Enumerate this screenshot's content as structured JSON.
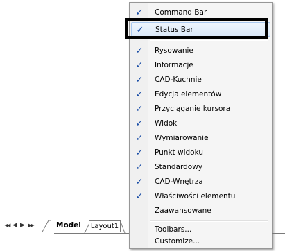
{
  "menu": {
    "items": [
      {
        "label": "Command Bar",
        "checked": true
      },
      {
        "label": "Status Bar",
        "checked": true,
        "highlighted": true
      },
      {
        "label": "Rysowanie",
        "checked": true
      },
      {
        "label": "Informacje",
        "checked": true
      },
      {
        "label": "CAD-Kuchnie",
        "checked": true
      },
      {
        "label": "Edycja elementów",
        "checked": true
      },
      {
        "label": "Przyciąganie kursora",
        "checked": true
      },
      {
        "label": "Widok",
        "checked": true
      },
      {
        "label": "Wymiarowanie",
        "checked": true
      },
      {
        "label": "Punkt widoku",
        "checked": true
      },
      {
        "label": "Standardowy",
        "checked": true
      },
      {
        "label": "CAD-Wnętrza",
        "checked": true
      },
      {
        "label": "Właściwości elementu",
        "checked": true
      },
      {
        "label": "Zaawansowane",
        "checked": false
      },
      {
        "label": "Toolbars...",
        "checked": false
      },
      {
        "label": "Customize...",
        "checked": false
      }
    ],
    "check_glyph": "✓"
  },
  "tabs": {
    "nav": [
      "◀◀",
      "◀",
      "▶",
      "▶▶"
    ],
    "model": "Model",
    "layout": "Layout1"
  },
  "colors": {
    "menu_bg": "#f5f5f5",
    "check": "#1c4fa7",
    "highlight_border": "#000000"
  }
}
